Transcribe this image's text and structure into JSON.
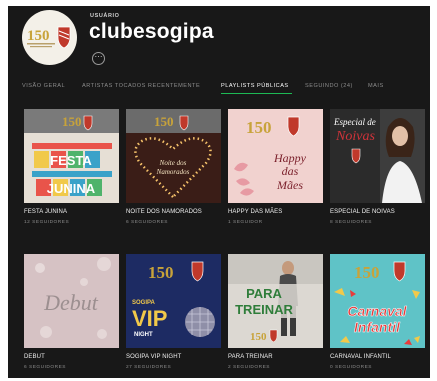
{
  "profile": {
    "kicker": "USUÁRIO",
    "name": "clubesogipa",
    "more_icon": "ellipsis-icon",
    "logo_number": "150"
  },
  "tabs": [
    {
      "label": "VISÃO GERAL",
      "active": false
    },
    {
      "label": "ARTISTAS TOCADOS RECENTEMENTE",
      "active": false
    },
    {
      "label": "PLAYLISTS PÚBLICAS",
      "active": true
    },
    {
      "label": "SEGUINDO (24)",
      "active": false
    },
    {
      "label": "MAIS",
      "active": false
    }
  ],
  "playlists": [
    {
      "title": "FESTA JUNINA",
      "followers": "12 SEGUIDORES",
      "cover_text": [
        "FESTA",
        "JUNINA"
      ],
      "cover_colors": [
        "#e6dfd5",
        "#e9544a"
      ]
    },
    {
      "title": "NOITE DOS NAMORADOS",
      "followers": "6 SEGUIDORES",
      "cover_text": [
        "Noite dos",
        "Namorados"
      ],
      "cover_colors": [
        "#3a1d17",
        "#f6c36b"
      ]
    },
    {
      "title": "HAPPY DAS MÃES",
      "followers": "1 SEGUIDOR",
      "cover_text": [
        "Happy",
        "das",
        "Mães"
      ],
      "cover_colors": [
        "#f1d2cf",
        "#7a1f2a"
      ]
    },
    {
      "title": "ESPECIAL DE NOIVAS",
      "followers": "8 SEGUIDORES",
      "cover_text": [
        "Especial de",
        "Noivas"
      ],
      "cover_colors": [
        "#2b2b2b",
        "#d0333a"
      ]
    },
    {
      "title": "DEBUT",
      "followers": "6 SEGUIDORES",
      "cover_text": [
        "Debut"
      ],
      "cover_colors": [
        "#d6c2c4",
        "#9c8f90"
      ]
    },
    {
      "title": "SOGIPA VIP NIGHT",
      "followers": "27 SEGUIDORES",
      "cover_text": [
        "SOGIPA",
        "VIP",
        "NIGHT"
      ],
      "cover_colors": [
        "#1d2b63",
        "#f1c94a"
      ]
    },
    {
      "title": "PARA TREINAR",
      "followers": "2 SEGUIDORES",
      "cover_text": [
        "PARA",
        "TREINAR"
      ],
      "cover_colors": [
        "#dcd8d2",
        "#2f7d3a"
      ]
    },
    {
      "title": "CARNAVAL INFANTIL",
      "followers": "0 SEGUIDORES",
      "cover_text": [
        "Carnaval",
        "Infantil"
      ],
      "cover_colors": [
        "#5fc3c7",
        "#e83b3b"
      ]
    }
  ]
}
